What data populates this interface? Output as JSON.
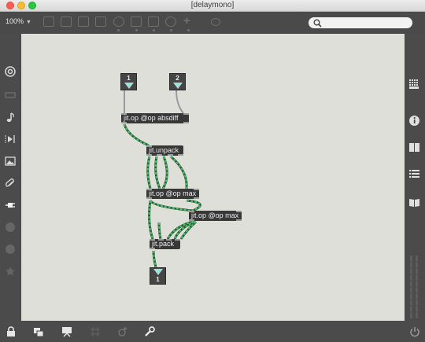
{
  "window": {
    "title": "[delaymono]"
  },
  "toolbar": {
    "zoom_label": "100%",
    "icons": [
      "presentation-icon",
      "mute-icon",
      "message-icon",
      "toggle-icon",
      "button-icon",
      "play-icon",
      "slider-icon",
      "dial-icon",
      "add-object-icon",
      "inspector-paint-icon"
    ]
  },
  "search": {
    "placeholder": "",
    "value": ""
  },
  "left_sidebar": {
    "icons": [
      "target-icon",
      "keyboard-icon",
      "music-note-icon",
      "media-play-icon",
      "image-icon",
      "paperclip-icon",
      "plug-icon",
      "info-circle-icon",
      "b-circle-icon",
      "star-icon"
    ]
  },
  "right_sidebar": {
    "icons": [
      "grid-dots-icon",
      "info-icon",
      "book-icon",
      "list-icon",
      "book-open-icon"
    ]
  },
  "patch": {
    "inlets": [
      {
        "label": "1"
      },
      {
        "label": "2"
      }
    ],
    "objects": [
      {
        "text": "jit.op @op absdiff"
      },
      {
        "text": "jit.unpack"
      },
      {
        "text": "jit.op @op max"
      },
      {
        "text": "jit.op @op max"
      },
      {
        "text": "jit.pack"
      }
    ],
    "outlets": [
      {
        "label": "1"
      }
    ]
  },
  "bottom_bar": {
    "icons": [
      "lock-icon",
      "new-view-icon",
      "presentation-mode-icon",
      "grid-icon",
      "snap-icon",
      "wrench-icon",
      "power-icon"
    ]
  },
  "colors": {
    "canvas": "#dfdfda",
    "chrome": "#4b4b4b",
    "object": "#383838",
    "matrix_cord": "#2f9a47",
    "port_arrow": "#a8dcd8"
  }
}
